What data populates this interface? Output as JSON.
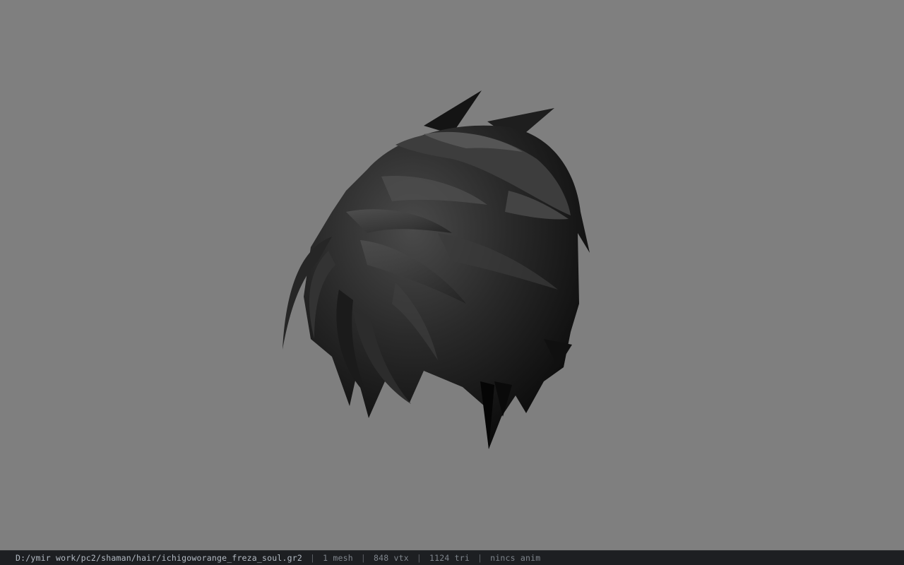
{
  "viewer": {
    "background_color": "#7f7f7f",
    "model_icon": "hair-mesh-model"
  },
  "statusbar": {
    "file_path": "D:/ymir work/pc2/shaman/hair/ichigoworange_freza_soul.gr2",
    "separator": "|",
    "mesh_count": "1 mesh",
    "vertex_count": "848 vtx",
    "triangle_count": "1124 tri",
    "anim_status": "nincs anim"
  }
}
